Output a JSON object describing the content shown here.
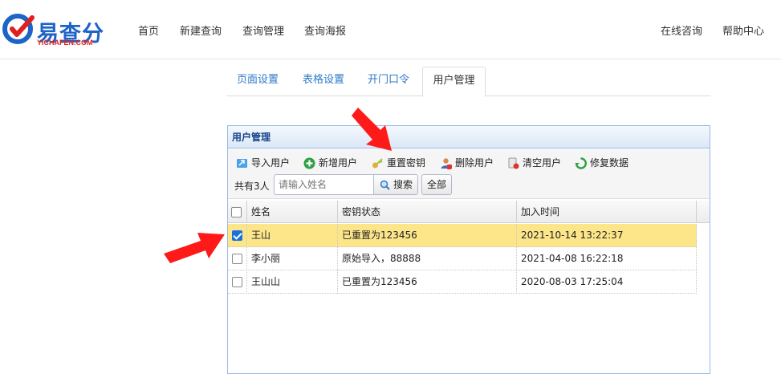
{
  "logo": {
    "brand": "易查分",
    "domain": "YICHAFEN.COM"
  },
  "nav": {
    "items": [
      "首页",
      "新建查询",
      "查询管理",
      "查询海报"
    ],
    "right": [
      "在线咨询",
      "帮助中心"
    ]
  },
  "tabs": [
    "页面设置",
    "表格设置",
    "开门口令",
    "用户管理"
  ],
  "panel": {
    "title": "用户管理",
    "toolbar": {
      "import": "导入用户",
      "add": "新增用户",
      "reset": "重置密钥",
      "delete": "删除用户",
      "clear": "清空用户",
      "repair": "修复数据"
    },
    "count_label": "共有3人",
    "search_placeholder": "请输入姓名",
    "search_button": "搜索",
    "all_button": "全部"
  },
  "grid": {
    "columns": [
      "姓名",
      "密钥状态",
      "加入时间"
    ],
    "rows": [
      {
        "name": "王山",
        "status": "已重置为123456",
        "time": "2021-10-14 13:22:37",
        "checked": true
      },
      {
        "name": "李小丽",
        "status": "原始导入，88888",
        "time": "2021-04-08 16:22:18",
        "checked": false
      },
      {
        "name": "王山山",
        "status": "已重置为123456",
        "time": "2020-08-03 17:25:04",
        "checked": false
      }
    ]
  },
  "colors": {
    "accent": "#2f7ac9",
    "selected_row": "#fde68a",
    "arrow": "#ff1a1a",
    "header_text": "#15428b"
  }
}
